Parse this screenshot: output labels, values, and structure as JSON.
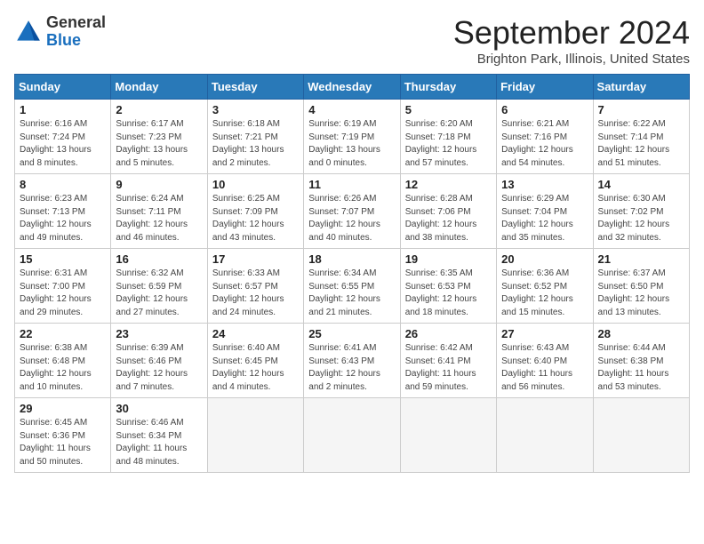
{
  "header": {
    "logo_general": "General",
    "logo_blue": "Blue",
    "month_title": "September 2024",
    "location": "Brighton Park, Illinois, United States"
  },
  "days_of_week": [
    "Sunday",
    "Monday",
    "Tuesday",
    "Wednesday",
    "Thursday",
    "Friday",
    "Saturday"
  ],
  "weeks": [
    [
      {
        "day": 1,
        "sunrise": "6:16 AM",
        "sunset": "7:24 PM",
        "daylight": "13 hours and 8 minutes."
      },
      {
        "day": 2,
        "sunrise": "6:17 AM",
        "sunset": "7:23 PM",
        "daylight": "13 hours and 5 minutes."
      },
      {
        "day": 3,
        "sunrise": "6:18 AM",
        "sunset": "7:21 PM",
        "daylight": "13 hours and 2 minutes."
      },
      {
        "day": 4,
        "sunrise": "6:19 AM",
        "sunset": "7:19 PM",
        "daylight": "13 hours and 0 minutes."
      },
      {
        "day": 5,
        "sunrise": "6:20 AM",
        "sunset": "7:18 PM",
        "daylight": "12 hours and 57 minutes."
      },
      {
        "day": 6,
        "sunrise": "6:21 AM",
        "sunset": "7:16 PM",
        "daylight": "12 hours and 54 minutes."
      },
      {
        "day": 7,
        "sunrise": "6:22 AM",
        "sunset": "7:14 PM",
        "daylight": "12 hours and 51 minutes."
      }
    ],
    [
      {
        "day": 8,
        "sunrise": "6:23 AM",
        "sunset": "7:13 PM",
        "daylight": "12 hours and 49 minutes."
      },
      {
        "day": 9,
        "sunrise": "6:24 AM",
        "sunset": "7:11 PM",
        "daylight": "12 hours and 46 minutes."
      },
      {
        "day": 10,
        "sunrise": "6:25 AM",
        "sunset": "7:09 PM",
        "daylight": "12 hours and 43 minutes."
      },
      {
        "day": 11,
        "sunrise": "6:26 AM",
        "sunset": "7:07 PM",
        "daylight": "12 hours and 40 minutes."
      },
      {
        "day": 12,
        "sunrise": "6:28 AM",
        "sunset": "7:06 PM",
        "daylight": "12 hours and 38 minutes."
      },
      {
        "day": 13,
        "sunrise": "6:29 AM",
        "sunset": "7:04 PM",
        "daylight": "12 hours and 35 minutes."
      },
      {
        "day": 14,
        "sunrise": "6:30 AM",
        "sunset": "7:02 PM",
        "daylight": "12 hours and 32 minutes."
      }
    ],
    [
      {
        "day": 15,
        "sunrise": "6:31 AM",
        "sunset": "7:00 PM",
        "daylight": "12 hours and 29 minutes."
      },
      {
        "day": 16,
        "sunrise": "6:32 AM",
        "sunset": "6:59 PM",
        "daylight": "12 hours and 27 minutes."
      },
      {
        "day": 17,
        "sunrise": "6:33 AM",
        "sunset": "6:57 PM",
        "daylight": "12 hours and 24 minutes."
      },
      {
        "day": 18,
        "sunrise": "6:34 AM",
        "sunset": "6:55 PM",
        "daylight": "12 hours and 21 minutes."
      },
      {
        "day": 19,
        "sunrise": "6:35 AM",
        "sunset": "6:53 PM",
        "daylight": "12 hours and 18 minutes."
      },
      {
        "day": 20,
        "sunrise": "6:36 AM",
        "sunset": "6:52 PM",
        "daylight": "12 hours and 15 minutes."
      },
      {
        "day": 21,
        "sunrise": "6:37 AM",
        "sunset": "6:50 PM",
        "daylight": "12 hours and 13 minutes."
      }
    ],
    [
      {
        "day": 22,
        "sunrise": "6:38 AM",
        "sunset": "6:48 PM",
        "daylight": "12 hours and 10 minutes."
      },
      {
        "day": 23,
        "sunrise": "6:39 AM",
        "sunset": "6:46 PM",
        "daylight": "12 hours and 7 minutes."
      },
      {
        "day": 24,
        "sunrise": "6:40 AM",
        "sunset": "6:45 PM",
        "daylight": "12 hours and 4 minutes."
      },
      {
        "day": 25,
        "sunrise": "6:41 AM",
        "sunset": "6:43 PM",
        "daylight": "12 hours and 2 minutes."
      },
      {
        "day": 26,
        "sunrise": "6:42 AM",
        "sunset": "6:41 PM",
        "daylight": "11 hours and 59 minutes."
      },
      {
        "day": 27,
        "sunrise": "6:43 AM",
        "sunset": "6:40 PM",
        "daylight": "11 hours and 56 minutes."
      },
      {
        "day": 28,
        "sunrise": "6:44 AM",
        "sunset": "6:38 PM",
        "daylight": "11 hours and 53 minutes."
      }
    ],
    [
      {
        "day": 29,
        "sunrise": "6:45 AM",
        "sunset": "6:36 PM",
        "daylight": "11 hours and 50 minutes."
      },
      {
        "day": 30,
        "sunrise": "6:46 AM",
        "sunset": "6:34 PM",
        "daylight": "11 hours and 48 minutes."
      },
      null,
      null,
      null,
      null,
      null
    ]
  ]
}
